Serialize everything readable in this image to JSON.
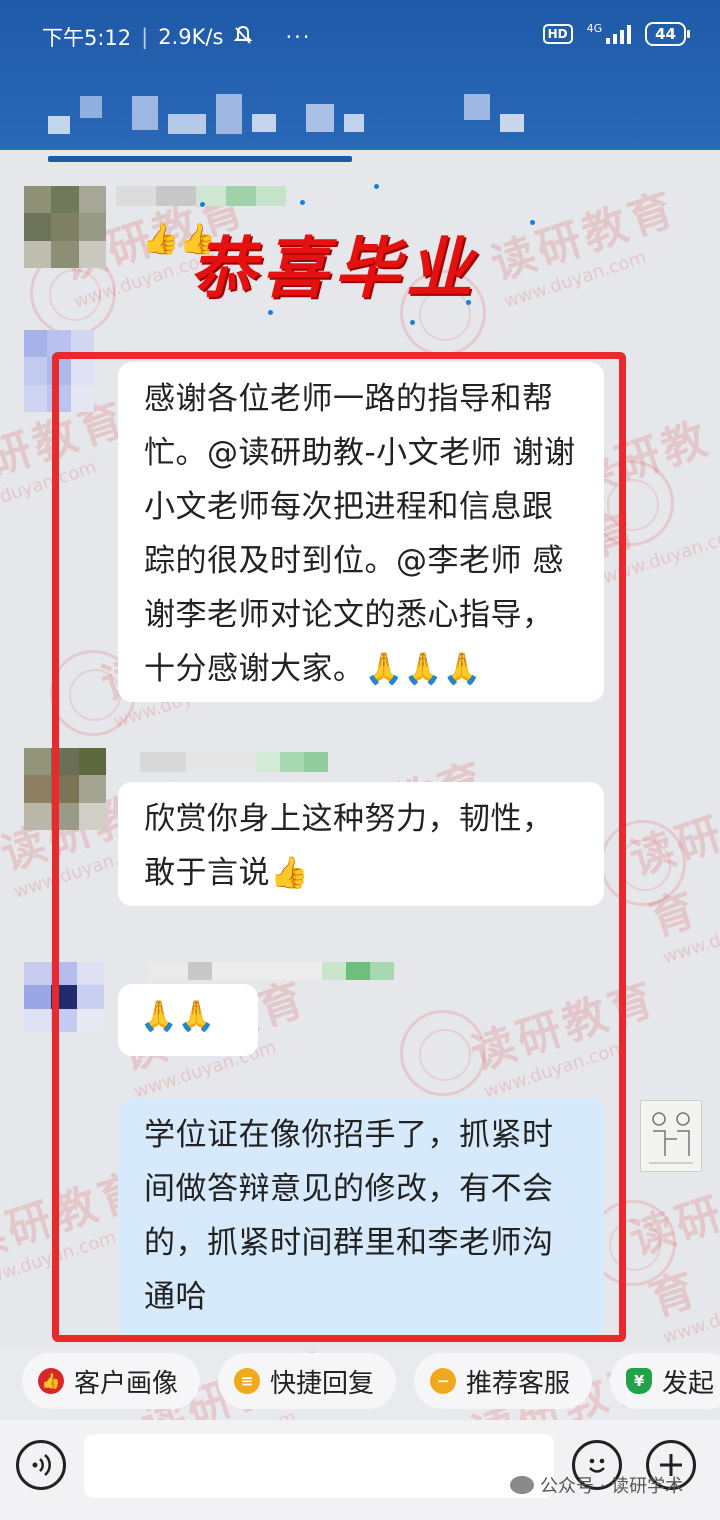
{
  "status_bar": {
    "time": "下午5:12",
    "speed": "2.9K/s",
    "more": "···",
    "hd": "HD",
    "network": "4G",
    "battery": "44"
  },
  "banner": {
    "text": "恭喜毕业"
  },
  "messages": [
    {
      "sender": "other",
      "text": "感谢各位老师一路的指导和帮忙。@读研助教-小文老师 谢谢小文老师每次把进程和信息跟踪的很及时到位。@李老师 感谢李老师对论文的悉心指导，十分感谢大家。🙏🙏🙏"
    },
    {
      "sender": "other",
      "text": "欣赏你身上这种努力，韧性，敢于言说👍"
    },
    {
      "sender": "other",
      "text": "🙏🙏"
    },
    {
      "sender": "me",
      "text": "学位证在像你招手了，抓紧时间做答辩意见的修改，有不会的，抓紧时间群里和李老师沟通哈"
    }
  ],
  "reaction_emoji": "👍👍",
  "quick_actions": [
    {
      "label": "客户画像",
      "icon": "thumb-icon",
      "color": "#d9262b"
    },
    {
      "label": "快捷回复",
      "icon": "reply-icon",
      "color": "#f0a81c"
    },
    {
      "label": "推荐客服",
      "icon": "service-icon",
      "color": "#f0a81c"
    },
    {
      "label": "发起",
      "icon": "yen-shield-icon",
      "color": "#22a34a"
    }
  ],
  "watermark": {
    "brand": "读研教育",
    "url": "www.duyan.com"
  },
  "footer_tag": "公众号 · 读研学术",
  "colors": {
    "header": "#1f5aa8",
    "highlight": "#e9292b",
    "my_bubble": "#d6eafb",
    "banner_red": "#e3110f"
  }
}
